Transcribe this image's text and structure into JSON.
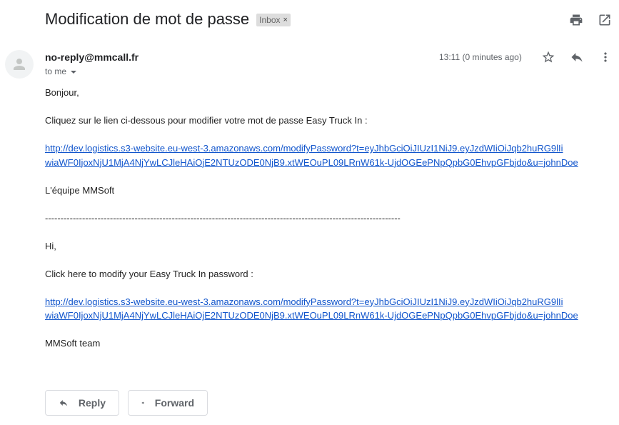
{
  "subject": {
    "title": "Modification de mot de passe",
    "label": "Inbox",
    "label_close": "×"
  },
  "message": {
    "sender": "no-reply@mmcall.fr",
    "recipient": "to me",
    "timestamp": "13:11 (0 minutes ago)"
  },
  "body": {
    "greeting_fr": "Bonjour,",
    "instruction_fr": "Cliquez sur le lien ci-dessous pour modifier votre mot de passe Easy Truck In :",
    "link_fr_line1": "http://dev.logistics.s3-website.eu-west-3.amazonaws.com/modifyPassword?t=eyJhbGciOiJIUzI1NiJ9.eyJzdWIiOiJqb2huRG9lIi",
    "link_fr_line2": "wiaWF0IjoxNjU1MjA4NjYwLCJleHAiOjE2NTUzODE0NjB9.xtWEOuPL09LRnW61k-UjdOGEePNpQpbG0EhvpGFbjdo&u=johnDoe",
    "signature_fr": "L'équipe MMSoft",
    "separator": "-------------------------------------------------------------------------------------------------------------------",
    "greeting_en": "Hi,",
    "instruction_en": "Click here to modify your Easy Truck In password :",
    "link_en_line1": "http://dev.logistics.s3-website.eu-west-3.amazonaws.com/modifyPassword?t=eyJhbGciOiJIUzI1NiJ9.eyJzdWIiOiJqb2huRG9lIi",
    "link_en_line2": "wiaWF0IjoxNjU1MjA4NjYwLCJleHAiOjE2NTUzODE0NjB9.xtWEOuPL09LRnW61k-UjdOGEePNpQpbG0EhvpGFbjdo&u=johnDoe",
    "signature_en": "MMSoft team"
  },
  "actions": {
    "reply_label": "Reply",
    "forward_label": "Forward"
  },
  "icons": {
    "print": "print-icon",
    "new_window": "open-in-new-window-icon",
    "star": "star-icon",
    "reply": "reply-icon",
    "more": "more-vertical-icon",
    "avatar": "person-icon"
  },
  "colors": {
    "link": "#1155cc",
    "label_bg": "#dddddd",
    "secondary_text": "#5f6368"
  }
}
